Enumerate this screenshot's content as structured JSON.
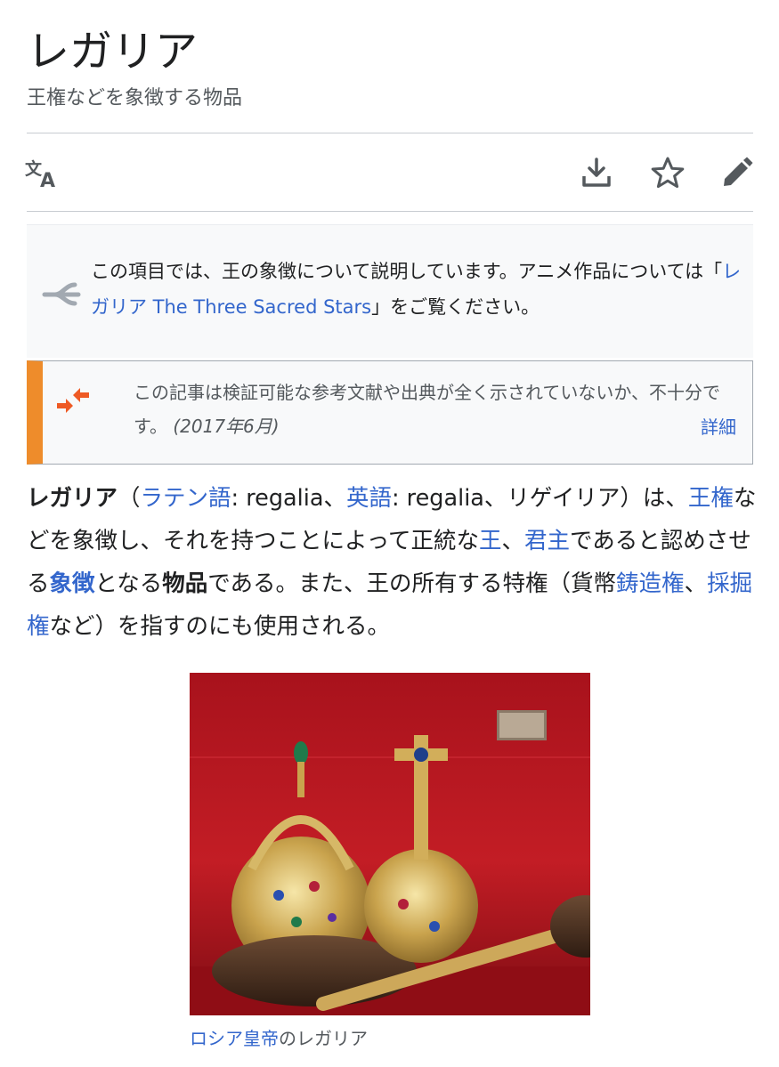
{
  "article": {
    "title": "レガリア",
    "subtitle": "王権などを象徴する物品"
  },
  "toolbar": {
    "language_icon": "translate-icon",
    "download_icon": "download-icon",
    "star_icon": "star-icon",
    "edit_icon": "edit-pencil-icon"
  },
  "hatnote": {
    "icon": "disambiguation-icon",
    "text_before": "この項目では、王の象徴について説明しています。アニメ作品については「",
    "link": "レガリア The Three Sacred Stars",
    "text_after": "」をご覧ください。"
  },
  "notice": {
    "icon": "merge-arrows-icon",
    "text": "この記事は検証可能な参考文献や出典が全く示されていないか、不十分です。",
    "date": "(2017年6月)",
    "more_link": "詳細"
  },
  "intro": {
    "term": "レガリア",
    "open_paren": "（",
    "latin_link": "ラテン語",
    "latin_value": ": regalia、",
    "english_link": "英語",
    "english_value": ": regalia、リゲイリア）は、",
    "kingship_link": "王権",
    "t1": "などを象徴し、それを持つことによって正統な",
    "king_link": "王",
    "sep1": "、",
    "monarch_link": "君主",
    "t2": "であると認めさせる",
    "symbol_link": "象徴",
    "t3": "となる",
    "object_bold": "物品",
    "t4": "である。また、王の所有する特権（貨幣",
    "minting_link": "鋳造権",
    "sep2": "、",
    "mining_link": "採掘権",
    "t5": "など）を指すのにも使用される。"
  },
  "figure": {
    "caption_link": "ロシア皇帝",
    "caption_rest": "のレガリア"
  },
  "colors": {
    "link": "#3366cc",
    "notice_accent": "#ee8c2b",
    "text": "#202122",
    "muted": "#54595d"
  }
}
